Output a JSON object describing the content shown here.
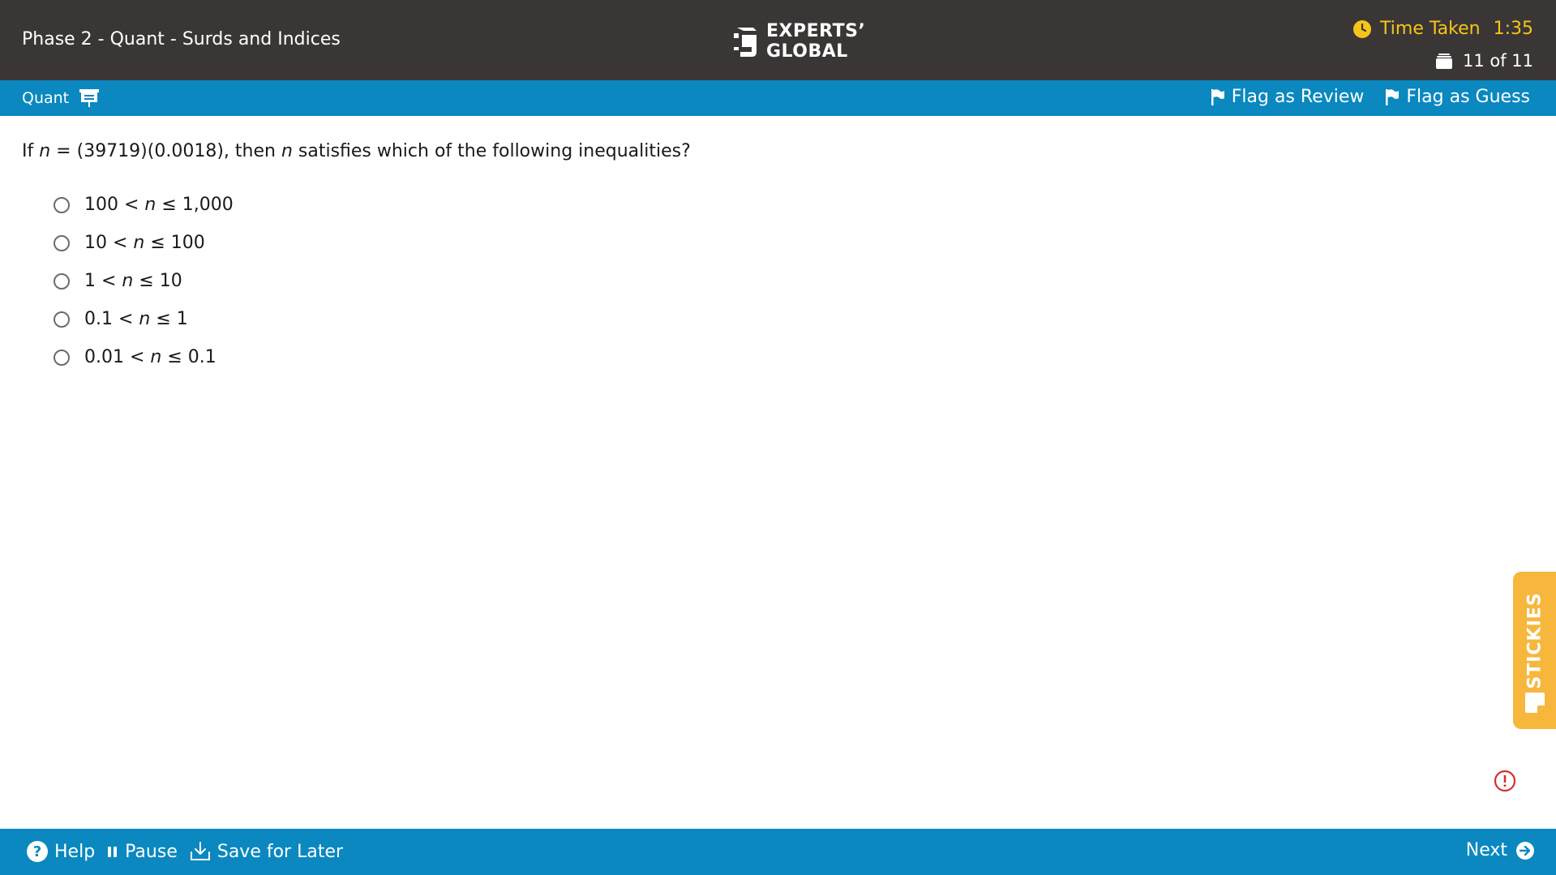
{
  "header": {
    "test_title": "Phase 2 - Quant - Surds and Indices",
    "logo_line1": "EXPERTS’",
    "logo_line2": "GLOBAL",
    "timer_label": "Time Taken",
    "timer_value": "1:35",
    "question_counter": "11 of 11"
  },
  "section_bar": {
    "section_name": "Quant",
    "flag_review_label": "Flag as Review",
    "flag_guess_label": "Flag as Guess"
  },
  "question": {
    "prefix": "If ",
    "var1": "n",
    "middle": " = (39719)(0.0018), then ",
    "var2": "n",
    "suffix": " satisfies which of the following inequalities?"
  },
  "options": [
    {
      "left": "100 < ",
      "var": "n",
      "right": " ≤ 1,000"
    },
    {
      "left": "10 < ",
      "var": "n",
      "right": " ≤ 100"
    },
    {
      "left": "1 < ",
      "var": "n",
      "right": " ≤ 10"
    },
    {
      "left": "0.1 < ",
      "var": "n",
      "right": " ≤ 1"
    },
    {
      "left": "0.01 < ",
      "var": "n",
      "right": " ≤ 0.1"
    }
  ],
  "stickies": {
    "label": "STICKIES"
  },
  "footer": {
    "help_label": "Help",
    "pause_label": "Pause",
    "save_label": "Save for Later",
    "next_label": "Next"
  },
  "colors": {
    "header_bg": "#3a3636",
    "accent_blue": "#0a88bf",
    "timer_yellow": "#f5c518",
    "stickies_orange": "#f6b73c",
    "alert_red": "#d32f2f"
  },
  "icons": [
    "clock-icon",
    "stack-icon",
    "whiteboard-icon",
    "flag-icon",
    "help-icon",
    "pause-icon",
    "download-icon",
    "next-arrow-icon",
    "sticky-note-icon",
    "alert-icon"
  ]
}
